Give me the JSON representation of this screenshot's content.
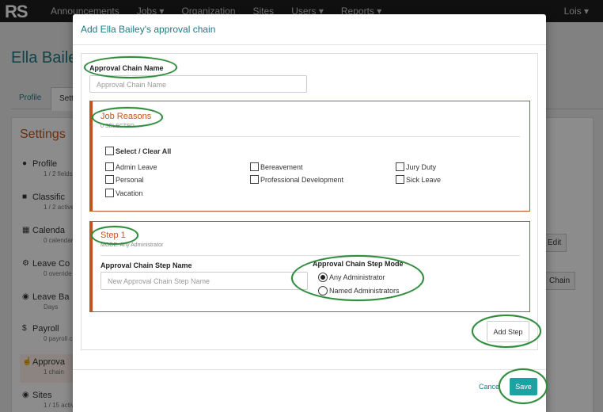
{
  "nav": {
    "logo": "RS",
    "items": [
      "Announcements",
      "Jobs ▾",
      "Organization",
      "Sites",
      "Users ▾",
      "Reports ▾"
    ],
    "user": "Lois ▾"
  },
  "background": {
    "page_title": "Ella Baile",
    "tabs": [
      "Profile",
      "Sett"
    ],
    "settings_title": "Settings",
    "settings_items": [
      {
        "label": "Profile",
        "sub": "1 / 2 fields",
        "icon": "user-icon"
      },
      {
        "label": "Classific",
        "sub": "1 / 2 active",
        "icon": "folder-icon"
      },
      {
        "label": "Calenda",
        "sub": "0 calendar",
        "icon": "calendar-icon"
      },
      {
        "label": "Leave Co",
        "sub": "0 override",
        "icon": "gear-icon"
      },
      {
        "label": "Leave Ba",
        "sub": "Days",
        "icon": "piggy-bank-icon"
      },
      {
        "label": "Payroll",
        "sub": "0 payroll c",
        "icon": "dollar-icon"
      },
      {
        "label": "Approva",
        "sub": "1 chain",
        "icon": "thumbs-up-icon"
      },
      {
        "label": "Sites",
        "sub": "1 / 15 activ",
        "icon": "map-marker-icon"
      }
    ],
    "edit_button": "Edit",
    "chain_button": "Chain"
  },
  "modal": {
    "title": "Add Ella Bailey's approval chain",
    "chain_name_label": "Approval Chain Name",
    "chain_name_placeholder": "Approval Chain Name",
    "job_reasons": {
      "title": "Job Reasons",
      "selected": "0 SELECTED",
      "select_all": "Select / Clear All",
      "options": [
        "Admin Leave",
        "Bereavement",
        "Jury Duty",
        "Personal",
        "Professional Development",
        "Sick Leave",
        "Vacation"
      ]
    },
    "step": {
      "title": "Step 1",
      "mode_text": "MODE: Any Administrator",
      "name_label": "Approval Chain Step Name",
      "name_placeholder": "New Approval Chain Step Name",
      "mode_label": "Approval Chain Step Mode",
      "mode_options": [
        "Any Administrator",
        "Named Administrators"
      ],
      "selected_mode": "Any Administrator"
    },
    "add_step_label": "Add Step",
    "cancel_label": "Cance",
    "save_label": "Save"
  },
  "colors": {
    "accent": "#1d7a83",
    "section": "#c0561c",
    "save": "#1ba2a2",
    "annotation": "#2e8b3b"
  }
}
